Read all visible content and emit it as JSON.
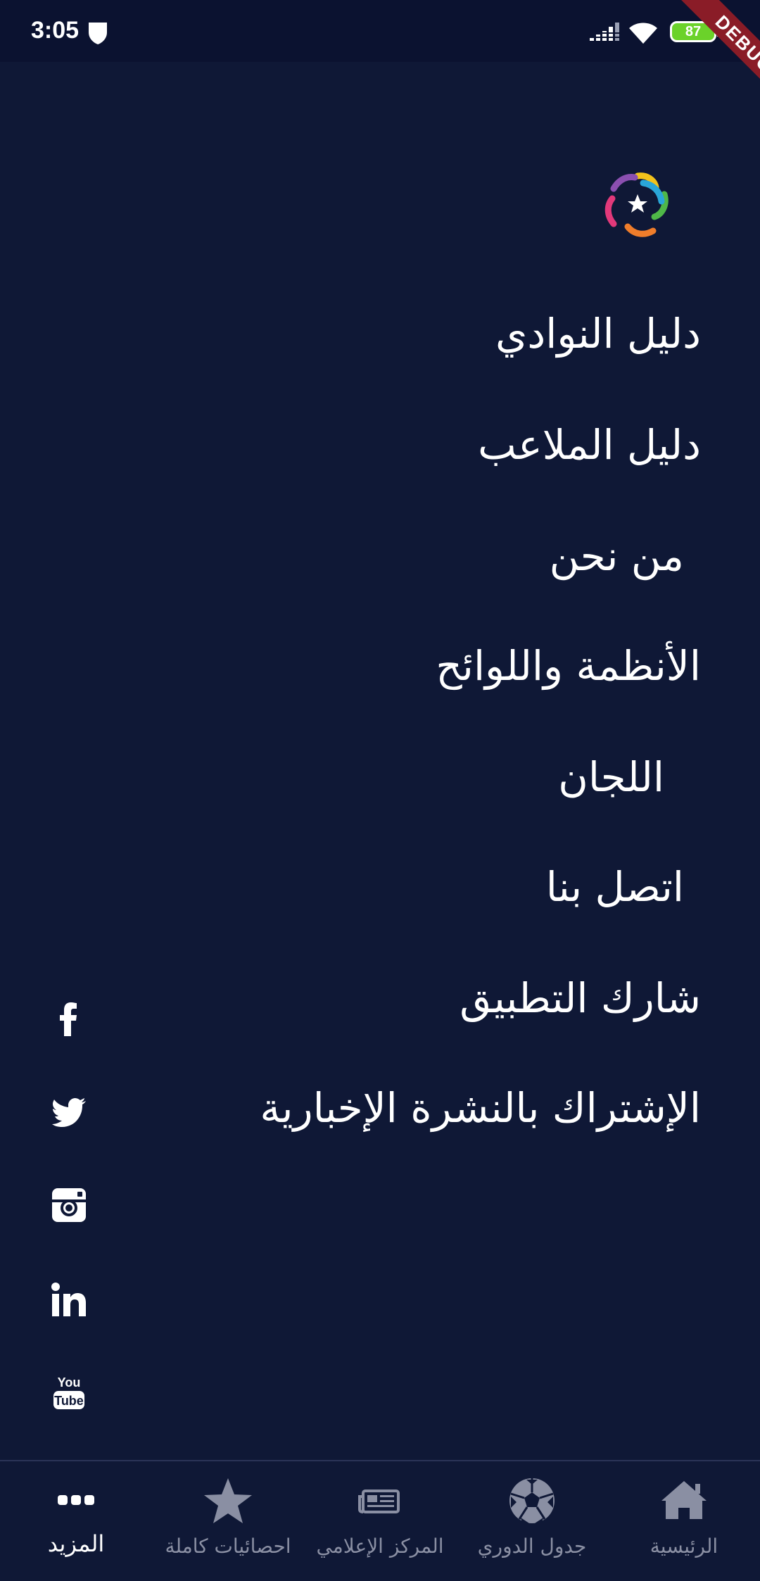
{
  "status_bar": {
    "time": "3:05",
    "battery_level": "87"
  },
  "debug_banner": "DEBUG",
  "logo": {
    "icon": "league-logo-icon"
  },
  "menu": {
    "items": [
      {
        "label": "دليل النوادي"
      },
      {
        "label": "دليل الملاعب"
      },
      {
        "label": "من نحن"
      },
      {
        "label": "الأنظمة واللوائح"
      },
      {
        "label": "اللجان"
      },
      {
        "label": "اتصل بنا"
      },
      {
        "label": "شارك التطبيق"
      },
      {
        "label": "الإشتراك بالنشرة الإخبارية"
      }
    ]
  },
  "social": {
    "icons": [
      "facebook-icon",
      "twitter-icon",
      "instagram-icon",
      "linkedin-icon",
      "youtube-icon"
    ],
    "youtube_text_top": "You",
    "youtube_text_bottom": "Tube"
  },
  "bottom_nav": {
    "items": [
      {
        "label": "الرئيسية",
        "icon": "home-icon"
      },
      {
        "label": "جدول الدوري",
        "icon": "soccer-ball-icon"
      },
      {
        "label": "المركز الإعلامي",
        "icon": "newspaper-icon"
      },
      {
        "label": "احصائيات كاملة",
        "icon": "star-icon"
      },
      {
        "label": "المزيد",
        "icon": "more-dots-icon",
        "active": true
      }
    ]
  },
  "colors": {
    "background": "#0f1836",
    "status_bar": "#0b1230",
    "inactive_nav": "#8a8fa3",
    "active_nav": "#ffffff",
    "debug_ribbon": "#8a1c27"
  }
}
